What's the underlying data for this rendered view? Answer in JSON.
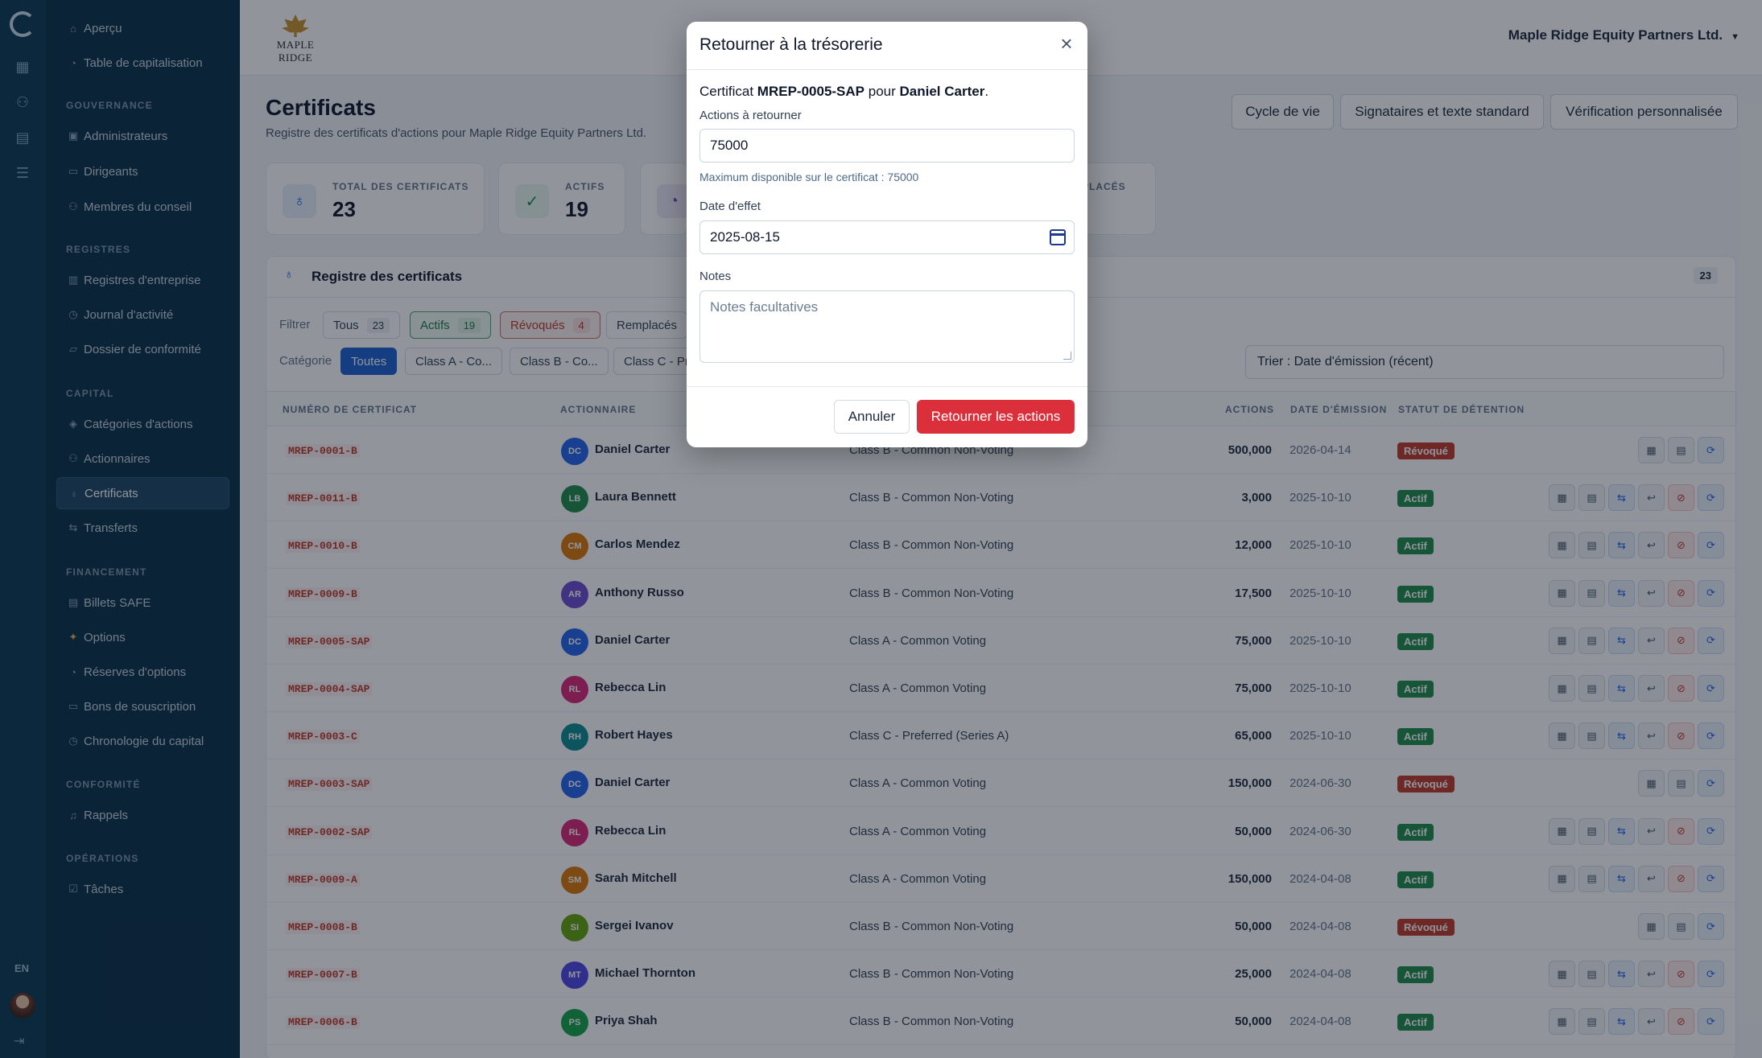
{
  "sidebar": {
    "items": [
      {
        "label": "Aperçu",
        "icon": "home-icon"
      },
      {
        "label": "Table de capitalisation",
        "icon": "pie-icon"
      },
      {
        "label": "Administrateurs",
        "icon": "id-badge-icon"
      },
      {
        "label": "Dirigeants",
        "icon": "briefcase-icon"
      },
      {
        "label": "Membres du conseil",
        "icon": "users-icon"
      },
      {
        "label": "Registres d'entreprise",
        "icon": "book-icon"
      },
      {
        "label": "Journal d'activité",
        "icon": "clock-icon"
      },
      {
        "label": "Dossier de conformité",
        "icon": "folder-icon"
      },
      {
        "label": "Catégories d'actions",
        "icon": "layers-icon"
      },
      {
        "label": "Actionnaires",
        "icon": "people-icon"
      },
      {
        "label": "Certificats",
        "icon": "award-icon"
      },
      {
        "label": "Transferts",
        "icon": "swap-icon"
      },
      {
        "label": "Billets SAFE",
        "icon": "document-icon"
      },
      {
        "label": "Options",
        "icon": "sparkle-icon"
      },
      {
        "label": "Réserves d'options",
        "icon": "pie-icon"
      },
      {
        "label": "Bons de souscription",
        "icon": "ticket-icon"
      },
      {
        "label": "Chronologie du capital",
        "icon": "history-icon"
      },
      {
        "label": "Rappels",
        "icon": "bell-icon"
      },
      {
        "label": "Tâches",
        "icon": "checkbox-icon"
      }
    ],
    "groups": [
      "GOUVERNANCE",
      "REGISTRES",
      "CAPITAL",
      "FINANCEMENT",
      "CONFORMITÉ",
      "OPÉRATIONS"
    ],
    "lang": "EN"
  },
  "header": {
    "logo_text": "MAPLE RIDGE",
    "company": "Maple Ridge Equity Partners Ltd."
  },
  "page": {
    "title": "Certificats",
    "subtitle": "Registre des certificats d'actions pour Maple Ridge Equity Partners Ltd.",
    "buttons": [
      "Cycle de vie",
      "Signataires et texte standard",
      "Vérification personnalisée"
    ]
  },
  "stats": [
    {
      "label": "TOTAL DES CERTIFICATS",
      "value": "23"
    },
    {
      "label": "ACTIFS",
      "value": "19"
    },
    {
      "label": "",
      "value": ""
    },
    {
      "label": "MPLACÉS",
      "value": ""
    }
  ],
  "registry": {
    "title": "Registre des certificats",
    "count": "23",
    "filter_label": "Filtrer",
    "filters": [
      {
        "label": "Tous",
        "count": "23"
      },
      {
        "label": "Actifs",
        "count": "19"
      },
      {
        "label": "Révoqués",
        "count": "4"
      },
      {
        "label": "Remplacés",
        "count": ""
      }
    ],
    "category_label": "Catégorie",
    "categories": [
      "Toutes",
      "Class A - Co...",
      "Class B - Co...",
      "Class C - Pr"
    ],
    "sort": "Trier : Date d'émission (récent)",
    "columns": [
      "NUMÉRO DE CERTIFICAT",
      "ACTIONNAIRE",
      "ACTIONS",
      "DATE D'ÉMISSION",
      "STATUT DE DÉTENTION"
    ],
    "rows": [
      {
        "cert": "MREP-0001-B",
        "initials": "DC",
        "holder": "Daniel Carter",
        "cls": "Class B - Common Non-Voting",
        "shares": "500,000",
        "date": "2026-04-14",
        "status": "Révoqué"
      },
      {
        "cert": "MREP-0011-B",
        "initials": "LB",
        "holder": "Laura Bennett",
        "cls": "Class B - Common Non-Voting",
        "shares": "3,000",
        "date": "2025-10-10",
        "status": "Actif"
      },
      {
        "cert": "MREP-0010-B",
        "initials": "CM",
        "holder": "Carlos Mendez",
        "cls": "Class B - Common Non-Voting",
        "shares": "12,000",
        "date": "2025-10-10",
        "status": "Actif"
      },
      {
        "cert": "MREP-0009-B",
        "initials": "AR",
        "holder": "Anthony Russo",
        "cls": "Class B - Common Non-Voting",
        "shares": "17,500",
        "date": "2025-10-10",
        "status": "Actif"
      },
      {
        "cert": "MREP-0005-SAP",
        "initials": "DC",
        "holder": "Daniel Carter",
        "cls": "Class A - Common Voting",
        "shares": "75,000",
        "date": "2025-10-10",
        "status": "Actif"
      },
      {
        "cert": "MREP-0004-SAP",
        "initials": "RL",
        "holder": "Rebecca Lin",
        "cls": "Class A - Common Voting",
        "shares": "75,000",
        "date": "2025-10-10",
        "status": "Actif"
      },
      {
        "cert": "MREP-0003-C",
        "initials": "RH",
        "holder": "Robert Hayes",
        "cls": "Class C - Preferred (Series A)",
        "shares": "65,000",
        "date": "2025-10-10",
        "status": "Actif"
      },
      {
        "cert": "MREP-0003-SAP",
        "initials": "DC",
        "holder": "Daniel Carter",
        "cls": "Class A - Common Voting",
        "shares": "150,000",
        "date": "2024-06-30",
        "status": "Révoqué"
      },
      {
        "cert": "MREP-0002-SAP",
        "initials": "RL",
        "holder": "Rebecca Lin",
        "cls": "Class A - Common Voting",
        "shares": "50,000",
        "date": "2024-06-30",
        "status": "Actif"
      },
      {
        "cert": "MREP-0009-A",
        "initials": "SM",
        "holder": "Sarah Mitchell",
        "cls": "Class A - Common Voting",
        "shares": "150,000",
        "date": "2024-04-08",
        "status": "Actif"
      },
      {
        "cert": "MREP-0008-B",
        "initials": "SI",
        "holder": "Sergei Ivanov",
        "cls": "Class B - Common Non-Voting",
        "shares": "50,000",
        "date": "2024-04-08",
        "status": "Révoqué"
      },
      {
        "cert": "MREP-0007-B",
        "initials": "MT",
        "holder": "Michael Thornton",
        "cls": "Class B - Common Non-Voting",
        "shares": "25,000",
        "date": "2024-04-08",
        "status": "Actif"
      },
      {
        "cert": "MREP-0006-B",
        "initials": "PS",
        "holder": "Priya Shah",
        "cls": "Class B - Common Non-Voting",
        "shares": "50,000",
        "date": "2024-04-08",
        "status": "Actif"
      }
    ]
  },
  "modal": {
    "title": "Retourner à la trésorerie",
    "intro_prefix": "Certificat ",
    "intro_cert": "MREP-0005-SAP",
    "intro_mid": " pour ",
    "intro_holder": "Daniel Carter",
    "intro_suffix": ".",
    "shares_label": "Actions à retourner",
    "shares_value": "75000",
    "shares_hint": "Maximum disponible sur le certificat : 75000",
    "date_label": "Date d'effet",
    "date_value": "2025-08-15",
    "notes_label": "Notes",
    "notes_placeholder": "Notes facultatives",
    "cancel": "Annuler",
    "submit": "Retourner les actions"
  },
  "colors": {
    "accent_red": "#dc2f3c",
    "active_green": "#1f8a4c",
    "revoked_red": "#c0392b",
    "sidebar_bg": "#0c3049",
    "rail_bg": "#0d3a55"
  }
}
